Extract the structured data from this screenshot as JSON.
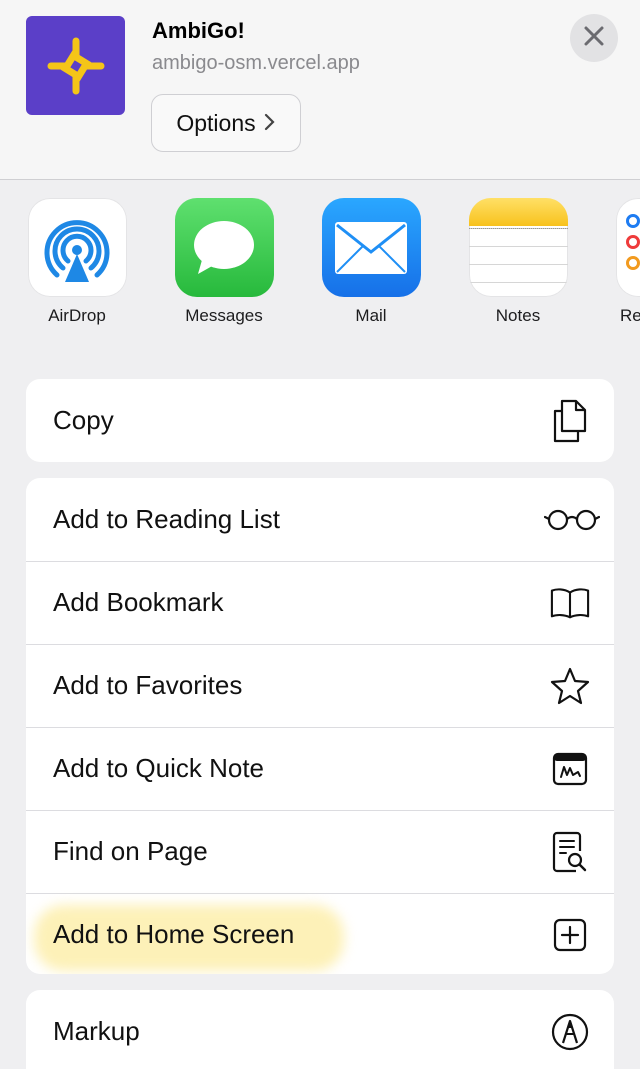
{
  "header": {
    "app_icon": "ambigo-logo-icon",
    "app_name": "AmbiGo!",
    "url": "ambigo-osm.vercel.app",
    "options_label": "Options",
    "options_icon": "chevron-right-icon",
    "close_icon": "close-icon"
  },
  "share_targets": [
    {
      "label": "AirDrop",
      "icon": "airdrop-icon"
    },
    {
      "label": "Messages",
      "icon": "messages-icon"
    },
    {
      "label": "Mail",
      "icon": "mail-icon"
    },
    {
      "label": "Notes",
      "icon": "notes-icon"
    },
    {
      "label": "Re",
      "icon": "reminders-icon"
    }
  ],
  "actions": {
    "copy": {
      "label": "Copy",
      "icon": "copy-icon"
    },
    "reading_list": {
      "label": "Add to Reading List",
      "icon": "glasses-icon"
    },
    "bookmark": {
      "label": "Add Bookmark",
      "icon": "book-icon"
    },
    "favorites": {
      "label": "Add to Favorites",
      "icon": "star-icon"
    },
    "quick_note": {
      "label": "Add to Quick Note",
      "icon": "quick-note-icon"
    },
    "find": {
      "label": "Find on Page",
      "icon": "find-on-page-icon"
    },
    "home_screen": {
      "label": "Add to Home Screen",
      "icon": "plus-square-icon"
    },
    "markup": {
      "label": "Markup",
      "icon": "markup-pen-icon"
    }
  },
  "colors": {
    "app_icon_bg": "#5b3fc8",
    "app_icon_fg": "#f5c518",
    "highlight": "#fdf1b8",
    "airdrop_blue": "#1e88e5",
    "messages_green": "#30c64a",
    "mail_blue": "#1f8ff5",
    "notes_yellow": "#fcd23a"
  }
}
